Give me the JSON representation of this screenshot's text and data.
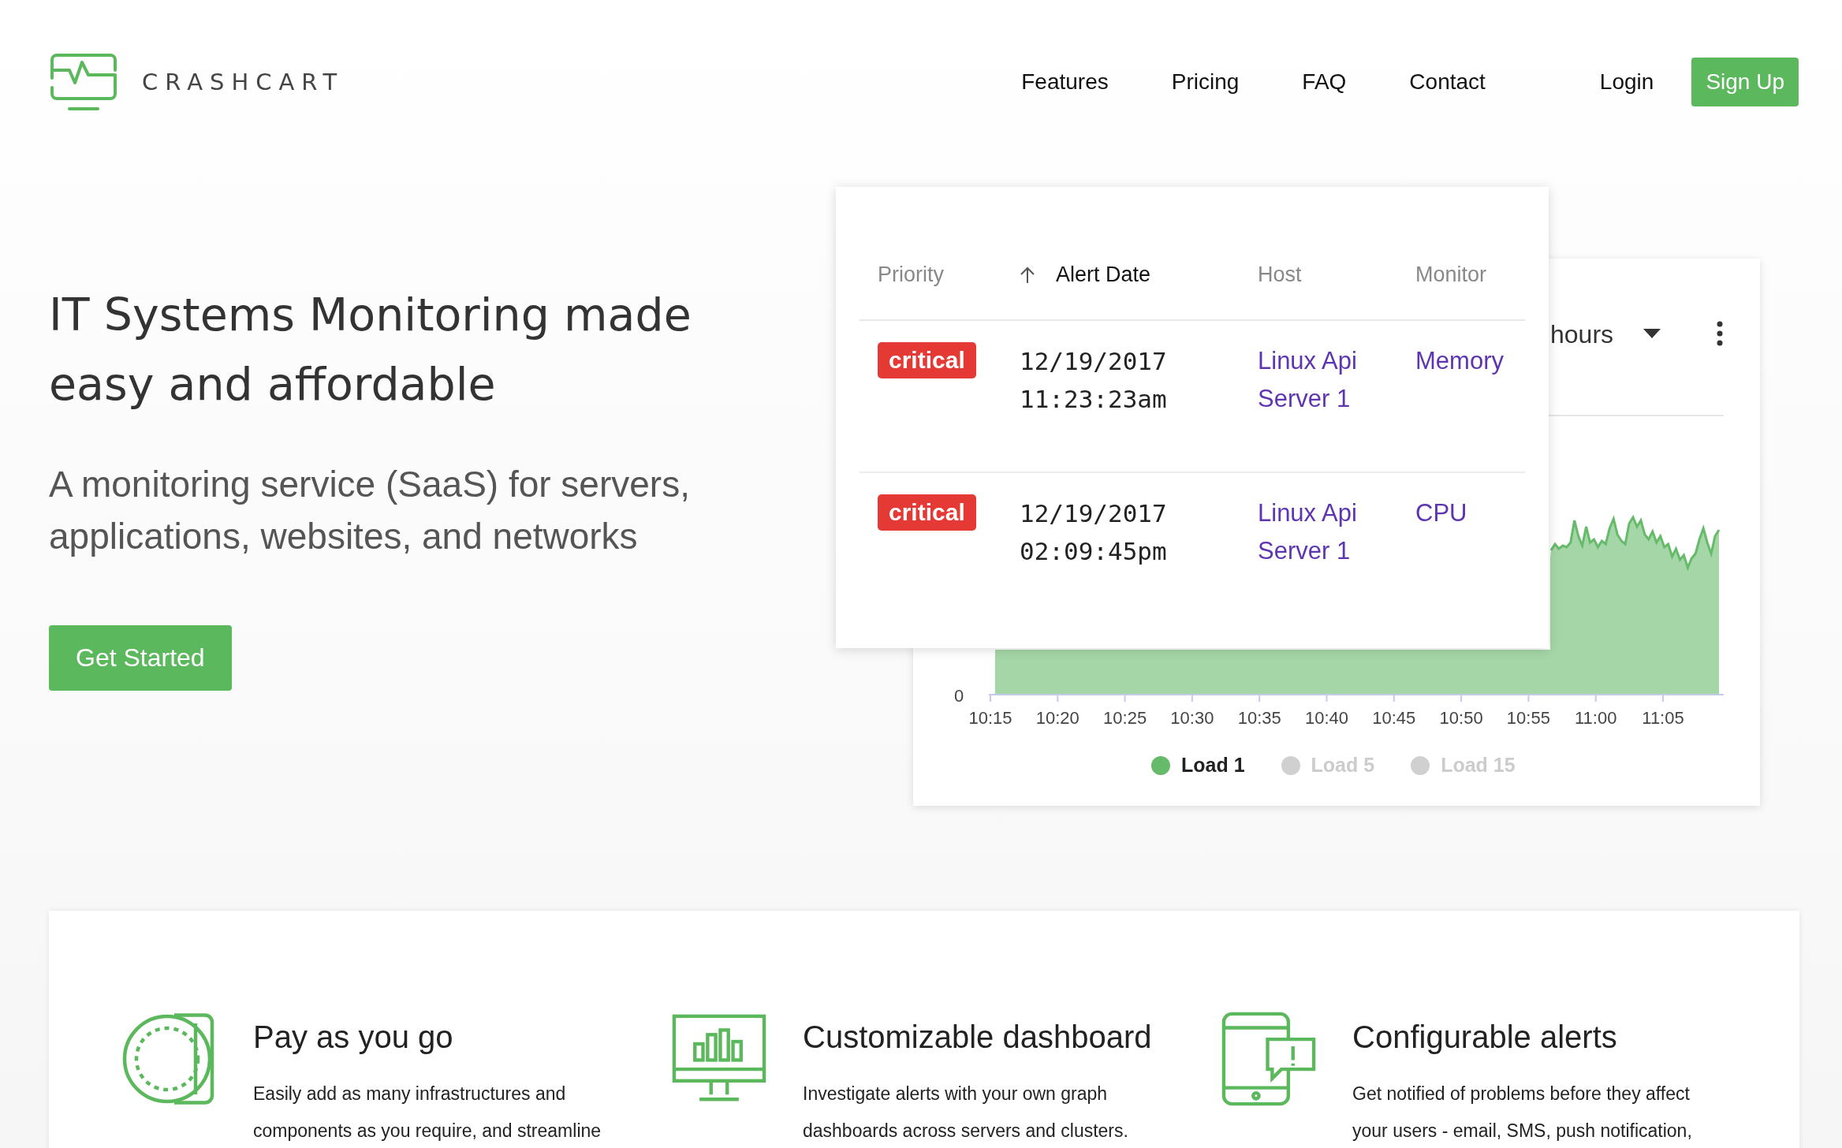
{
  "header": {
    "brand": "CRASHCART",
    "nav": [
      {
        "label": "Features",
        "kind": "link"
      },
      {
        "label": "Pricing",
        "kind": "link"
      },
      {
        "label": "FAQ",
        "kind": "link"
      },
      {
        "label": "Contact",
        "kind": "link"
      },
      {
        "label": "Login",
        "kind": "link"
      },
      {
        "label": "Sign Up",
        "kind": "button"
      }
    ]
  },
  "hero": {
    "title": "IT Systems Monitoring made easy and affordable",
    "subtitle": "A monitoring service (SaaS) for servers, applications, websites, and networks",
    "cta": "Get Started"
  },
  "alerts_table": {
    "columns": [
      {
        "label": "Priority",
        "sorted": false
      },
      {
        "label": "Alert Date",
        "sorted": true
      },
      {
        "label": "Host",
        "sorted": false
      },
      {
        "label": "Monitor",
        "sorted": false
      }
    ],
    "rows": [
      {
        "priority": "critical",
        "date": "12/19/2017",
        "time": "11:23:23am",
        "host": "Linux Api Server 1",
        "monitor": "Memory"
      },
      {
        "priority": "critical",
        "date": "12/19/2017",
        "time": "02:09:45pm",
        "host": "Linux Api Server 1",
        "monitor": "CPU"
      }
    ]
  },
  "chart_card": {
    "range": "hours",
    "y_tick_label": "0",
    "x_tick_labels": [
      "10:15",
      "10:20",
      "10:25",
      "10:30",
      "10:35",
      "10:40",
      "10:45",
      "10:50",
      "10:55",
      "11:00",
      "11:05"
    ],
    "legend": [
      {
        "label": "Load 1",
        "selected": true
      },
      {
        "label": "Load 5",
        "selected": false
      },
      {
        "label": "Load 15",
        "selected": false
      }
    ]
  },
  "features": [
    {
      "kind": "coin",
      "title": "Pay as you go",
      "text": "Easily add as many infrastructures and components as you require, and streamline"
    },
    {
      "kind": "dashboard",
      "title": "Customizable dashboard",
      "text": "Investigate alerts with your own graph dashboards across servers and clusters."
    },
    {
      "kind": "alert",
      "title": "Configurable alerts",
      "text": "Get notified of problems before they affect your users - email, SMS, push notification,"
    }
  ]
}
